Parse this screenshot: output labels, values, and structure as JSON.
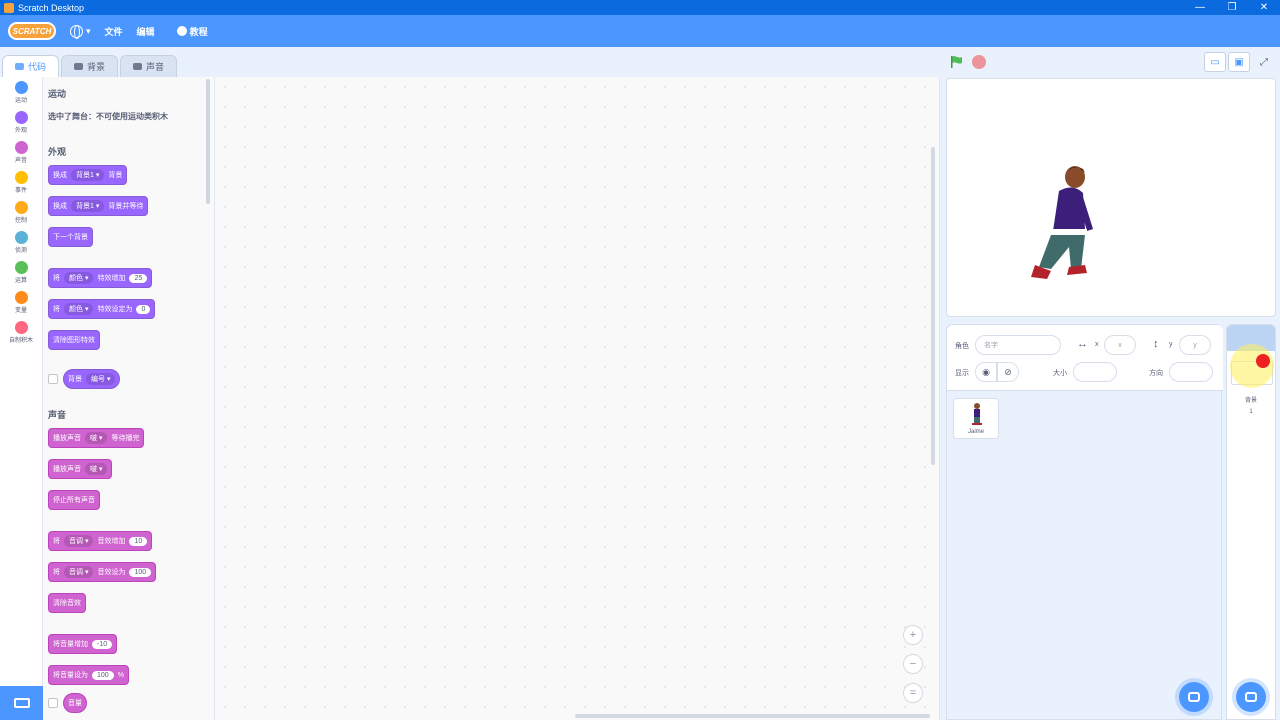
{
  "window": {
    "title": "Scratch Desktop",
    "buttons": [
      "—",
      "❐",
      "✕"
    ]
  },
  "menubar": {
    "logo": "SCRATCH",
    "file": "文件",
    "edit": "编辑",
    "tutorials": "教程"
  },
  "tabs": [
    {
      "label": "代码",
      "active": true
    },
    {
      "label": "背景",
      "active": false
    },
    {
      "label": "声音",
      "active": false
    }
  ],
  "categories": [
    {
      "label": "运动",
      "color": "#4c97ff"
    },
    {
      "label": "外观",
      "color": "#9966ff"
    },
    {
      "label": "声音",
      "color": "#cf63cf"
    },
    {
      "label": "事件",
      "color": "#ffbf00"
    },
    {
      "label": "控制",
      "color": "#ffab19"
    },
    {
      "label": "侦测",
      "color": "#5cb1d6"
    },
    {
      "label": "运算",
      "color": "#59c059"
    },
    {
      "label": "变量",
      "color": "#ff8c1a"
    },
    {
      "label": "自制积木",
      "color": "#ff6680"
    }
  ],
  "palette": {
    "motion_title": "运动",
    "motion_note": "选中了舞台：不可使用运动类积木",
    "looks_title": "外观",
    "looks_blocks": [
      {
        "a": "换成",
        "dd": "背景1 ▾",
        "b": "背景"
      },
      {
        "a": "换成",
        "dd": "背景1 ▾",
        "b": "背景并等待"
      },
      {
        "a": "下一个背景"
      },
      {
        "a": "将",
        "dd": "颜色 ▾",
        "b": "特效增加",
        "num": "25"
      },
      {
        "a": "将",
        "dd": "颜色 ▾",
        "b": "特效设定为",
        "num": "0"
      },
      {
        "a": "清除图形特效"
      }
    ],
    "looks_reporter": {
      "a": "背景",
      "dd": "编号 ▾"
    },
    "sound_title": "声音",
    "sound_blocks": [
      {
        "a": "播放声音",
        "dd": "啵 ▾",
        "b": "等待播完"
      },
      {
        "a": "播放声音",
        "dd": "啵 ▾"
      },
      {
        "a": "停止所有声音"
      },
      {
        "a": "将",
        "dd": "音调 ▾",
        "b": "音效增加",
        "num": "10"
      },
      {
        "a": "将",
        "dd": "音调 ▾",
        "b": "音效设为",
        "num": "100"
      },
      {
        "a": "清除音效"
      },
      {
        "a": "将音量增加",
        "num": "-10"
      },
      {
        "a": "将音量设为",
        "num": "100",
        "b": "%"
      }
    ],
    "sound_reporter": "音量"
  },
  "zoom": {
    "in": "+",
    "out": "−",
    "reset": "="
  },
  "sprite_info": {
    "sprite_label": "角色",
    "name_placeholder": "名字",
    "x_label": "x",
    "x_placeholder": "x",
    "y_label": "y",
    "y_placeholder": "y",
    "show_label": "显示",
    "size_label": "大小",
    "direction_label": "方向"
  },
  "sprites": [
    {
      "name": "Jaime"
    }
  ],
  "stage_selector": {
    "label": "背景",
    "count": "1"
  }
}
